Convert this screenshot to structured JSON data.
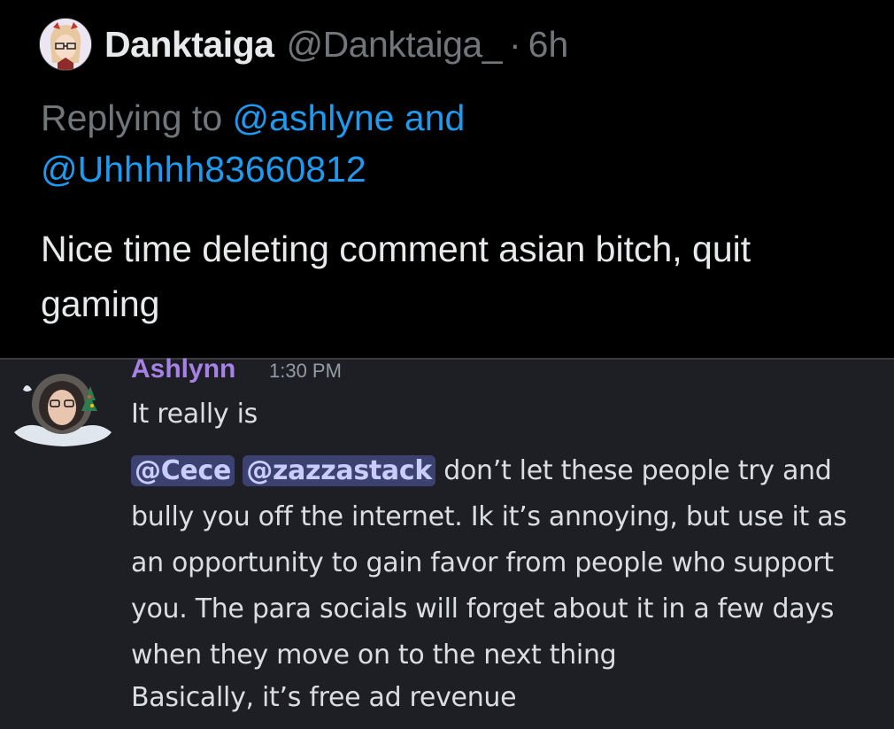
{
  "tweet": {
    "display_name": "Danktaiga",
    "handle": "@Danktaiga_",
    "separator": "·",
    "time": "6h",
    "reply_prefix": "Replying to",
    "reply_mention_1": "@ashlyne",
    "reply_and": "and",
    "reply_mention_2": "@Uhhhhh83660812",
    "text": "Nice time deleting comment asian bitch, quit gaming"
  },
  "discord": {
    "username": "Ashlynn",
    "timestamp": "1:30 PM",
    "message_1": "It really is",
    "mention_1": "@Cece",
    "mention_2": "@zazzastack",
    "message_2": " don’t let these people try and bully you off the internet. Ik it’s annoying, but use it as an opportunity to gain favor from people who support you. The para socials will forget about it in a few days when they move on to the next thing",
    "message_3": "Basically, it’s free ad revenue"
  },
  "colors": {
    "tweet_bg": "#000000",
    "twitter_link": "#1d9bf0",
    "twitter_secondary": "#71767b",
    "discord_bg": "#1e1f24",
    "discord_username": "#a682e6",
    "discord_mention_bg": "#3c4270"
  },
  "icons": {
    "tweet_avatar": "anime-avatar",
    "discord_avatar": "user-photo-avatar"
  }
}
